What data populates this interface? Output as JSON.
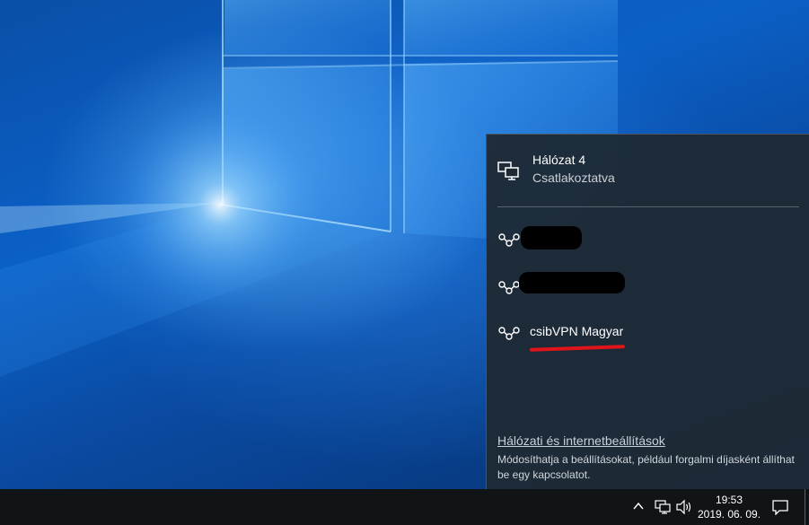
{
  "network_flyout": {
    "connection": {
      "name": "Hálózat 4",
      "status": "Csatlakoztatva",
      "icon": "ethernet-icon"
    },
    "vpn_connections": [
      {
        "label": "",
        "redacted": true,
        "icon": "vpn-icon"
      },
      {
        "label": "",
        "redacted": true,
        "icon": "vpn-icon"
      },
      {
        "label": "csibVPN Magyar",
        "redacted": false,
        "highlighted": true,
        "icon": "vpn-icon"
      }
    ],
    "settings_link": "Hálózati és internetbeállítások",
    "settings_description": "Módosíthatja a beállításokat, például forgalmi díjasként állíthat be egy kapcsolatot."
  },
  "taskbar": {
    "clock_time": "19:53",
    "clock_date": "2019. 06. 09.",
    "tray_icons": [
      "chevron-up-icon",
      "network-icon",
      "volume-icon"
    ],
    "action_center_icon": "action-center-icon"
  },
  "colors": {
    "flyout_background": "#1f2933",
    "taskbar_background": "#101417",
    "highlight_underline": "#e0151b",
    "wallpaper_blue": "#0b60c6"
  }
}
